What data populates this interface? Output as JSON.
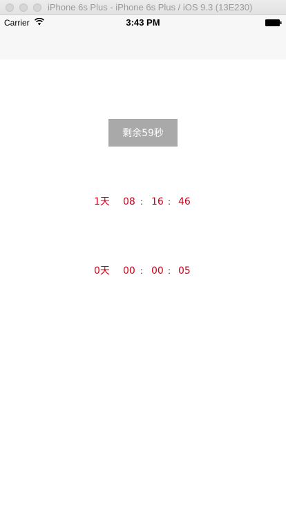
{
  "window": {
    "title": "iPhone 6s Plus - iPhone 6s Plus / iOS 9.3 (13E230)"
  },
  "status_bar": {
    "carrier": "Carrier",
    "time": "3:43 PM",
    "icons": [
      "wifi-icon",
      "battery-icon"
    ]
  },
  "button": {
    "label": "剩余59秒"
  },
  "timers": [
    {
      "days": "1天",
      "hours": "08",
      "minutes": "16",
      "seconds": "46",
      "separator": ":"
    },
    {
      "days": "0天",
      "hours": "00",
      "minutes": "00",
      "seconds": "05",
      "separator": ":"
    }
  ],
  "colors": {
    "timer_text": "#d0021b",
    "button_bg": "#a9a9a9",
    "button_text": "#ffffff"
  }
}
